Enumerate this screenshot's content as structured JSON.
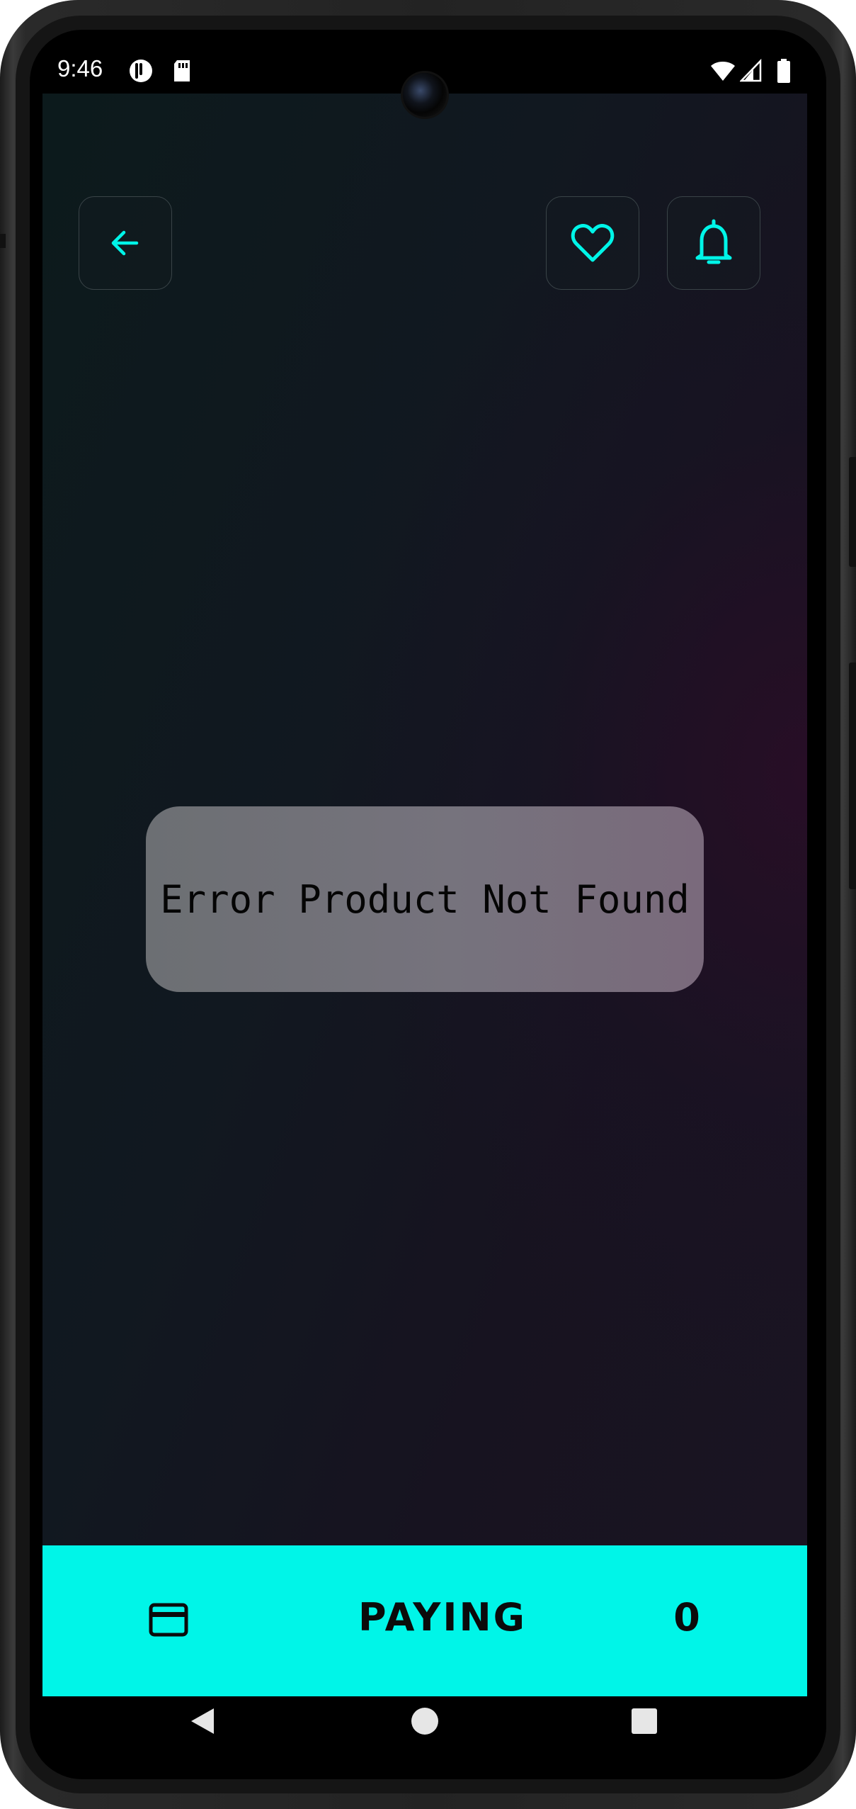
{
  "status_bar": {
    "time": "9:46",
    "left_icons": [
      "circle-app-icon",
      "sd-card-icon"
    ],
    "right_icons": [
      "wifi-icon",
      "cell-signal-icon",
      "battery-icon"
    ]
  },
  "header": {
    "back_icon": "arrow-left-icon",
    "favorite_icon": "heart-icon",
    "notification_icon": "bell-icon",
    "accent_color": "#00f5e8"
  },
  "message": {
    "text": "Error Product Not Found"
  },
  "pay_bar": {
    "icon": "credit-card-icon",
    "label": "PAYING",
    "amount": "0",
    "background_color": "#00f5e8"
  },
  "system_nav": {
    "buttons": [
      "back-triangle-icon",
      "home-circle-icon",
      "recents-square-icon"
    ]
  }
}
